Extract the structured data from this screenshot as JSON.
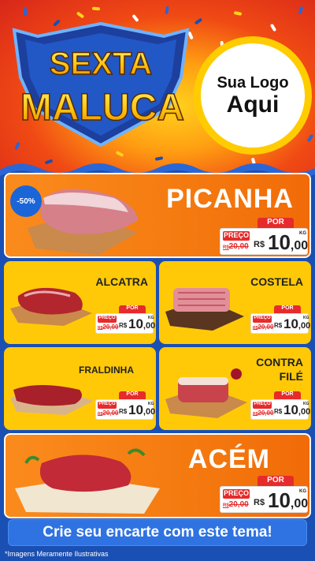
{
  "header": {
    "title_line1": "SEXTA",
    "title_line2": "MALUCA",
    "logo_line1": "Sua Logo",
    "logo_line2": "Aqui"
  },
  "featured_badge": "-50%",
  "products": [
    {
      "name": "PICANHA",
      "por": "POR",
      "preco": "PREÇO",
      "old_currency": "R$",
      "old_price": "20,00",
      "currency": "R$",
      "price_int": "10",
      "price_dec": ",00",
      "unit": "KG"
    },
    {
      "name": "ALCATRA",
      "por": "POR",
      "preco": "PREÇO",
      "old_currency": "R$",
      "old_price": "20,00",
      "currency": "R$",
      "price_int": "10",
      "price_dec": ",00",
      "unit": "KG"
    },
    {
      "name": "COSTELA",
      "por": "POR",
      "preco": "PREÇO",
      "old_currency": "R$",
      "old_price": "20,00",
      "currency": "R$",
      "price_int": "10",
      "price_dec": ",00",
      "unit": "KG"
    },
    {
      "name": "FRALDINHA",
      "por": "POR",
      "preco": "PREÇO",
      "old_currency": "R$",
      "old_price": "20,00",
      "currency": "R$",
      "price_int": "10",
      "price_dec": ",00",
      "unit": "KG"
    },
    {
      "name_line1": "CONTRA",
      "name_line2": "FILÉ",
      "por": "POR",
      "preco": "PREÇO",
      "old_currency": "R$",
      "old_price": "20,00",
      "currency": "R$",
      "price_int": "10",
      "price_dec": ",00",
      "unit": "KG"
    },
    {
      "name": "ACÉM",
      "por": "POR",
      "preco": "PREÇO",
      "old_currency": "R$",
      "old_price": "20,00",
      "currency": "R$",
      "price_int": "10",
      "price_dec": ",00",
      "unit": "KG"
    }
  ],
  "banner": "Crie seu encarte com este tema!",
  "footnote": "*Imagens Meramente Ilustrativas",
  "colors": {
    "card_yellow": "#ffc907",
    "card_orange": "#f47a10",
    "price_red": "#e72a2a",
    "banner_blue": "#2f73e2"
  }
}
